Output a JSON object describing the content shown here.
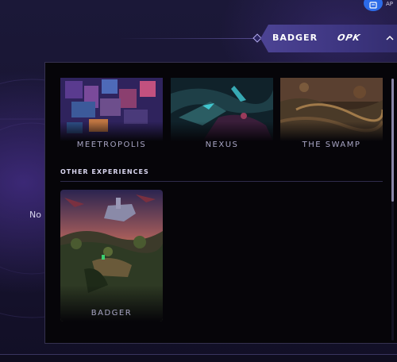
{
  "header": {
    "title": "BADGER",
    "brand_logo": "OPK",
    "toggle_icon": "chevron-up-icon"
  },
  "app_shortcut": {
    "label": "AP",
    "icon": "app-icon"
  },
  "background": {
    "partial_text": "No a"
  },
  "games": [
    {
      "title": "MEETROPOLIS"
    },
    {
      "title": "NEXUS"
    },
    {
      "title": "THE SWAMP"
    }
  ],
  "other_experiences": {
    "heading": "OTHER EXPERIENCES",
    "items": [
      {
        "title": "BADGER"
      }
    ]
  },
  "colors": {
    "accent": "#4c4394",
    "panel_bg": "#060509",
    "text_muted": "#a8a5c4",
    "app_icon": "#2c6be8"
  }
}
